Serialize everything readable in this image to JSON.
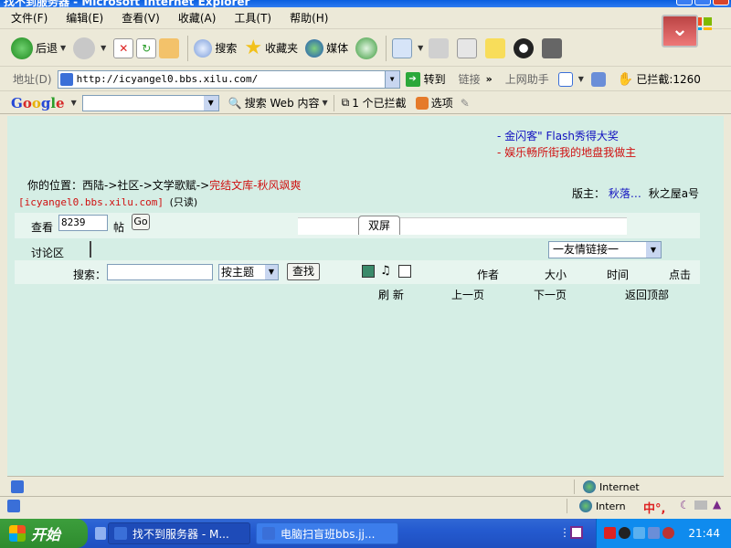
{
  "window": {
    "title": "找不到服务器 - Microsoft Internet Explorer"
  },
  "menu": [
    "文件(F)",
    "编辑(E)",
    "查看(V)",
    "收藏(A)",
    "工具(T)",
    "帮助(H)"
  ],
  "toolbar": {
    "back": "后退",
    "search": "搜索",
    "favorites": "收藏夹",
    "media": "媒体"
  },
  "address": {
    "label": "地址(D)",
    "url": "http://icyangel0.bbs.xilu.com/",
    "go": "转到",
    "links": "链接",
    "helper": "上网助手",
    "blocked": "已拦截:1260"
  },
  "google": {
    "logo": [
      "G",
      "o",
      "o",
      "g",
      "l",
      "e"
    ],
    "search_web": "搜索 Web 内容",
    "blocked": "1 个已拦截",
    "options": "选项"
  },
  "content": {
    "ann1": "- 金闪客\" Flash秀得大奖",
    "ann2": "- 娱乐畅所街我的地盘我做主",
    "location_prefix": "你的位置：西陆->社区->文学歌赋->",
    "location_current": "完结文库-秋风飒爽",
    "host": "[icyangel0.bbs.xilu.com]",
    "readonly": "(只读)",
    "moderators_label": "版主：",
    "moderator1": "秋落…",
    "moderator2": "秋之屋a号",
    "view_label": "查看",
    "view_value": "8239",
    "view_unit": "帖",
    "go_btn": "Go",
    "tab": "双屏",
    "discussion": "讨论区",
    "friend_select": "一友情链接一",
    "search_label": "搜索：",
    "search_by": "按主题",
    "find_btn": "查找",
    "columns": {
      "author": "作者",
      "size": "大小",
      "time": "时间",
      "clicks": "点击"
    },
    "nav": {
      "refresh": "刷 新",
      "prev": "上一页",
      "next": "下一页",
      "top": "返回顶部"
    }
  },
  "status": {
    "zone1": "Internet",
    "zone2": "Intern"
  },
  "taskbar": {
    "start": "开始",
    "tasks": [
      "找不到服务器 - M...",
      "电脑扫盲班bbs.jj..."
    ],
    "time": "21:44",
    "ime": "中°,"
  }
}
